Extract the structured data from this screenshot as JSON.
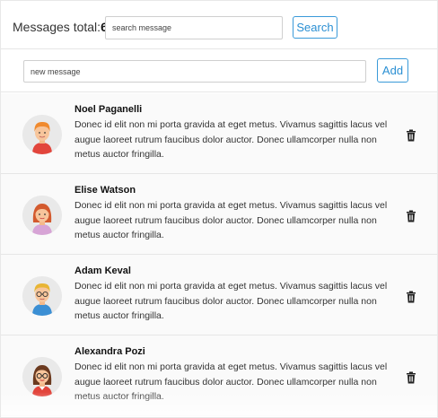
{
  "header": {
    "total_label": "Messages total:",
    "total_count": "6",
    "search_placeholder": "search message",
    "search_button": "Search"
  },
  "composer": {
    "placeholder": "new message",
    "add_button": "Add"
  },
  "messages": [
    {
      "author": "Noel Paganelli",
      "text": "Donec id elit non mi porta gravida at eget metus. Vivamus sagittis lacus vel augue laoreet rutrum faucibus dolor auctor. Donec ullamcorper nulla non metus auctor fringilla.",
      "avatar_icon": "man-red-hair-avatar-icon"
    },
    {
      "author": "Elise Watson",
      "text": "Donec id elit non mi porta gravida at eget metus. Vivamus sagittis lacus vel augue laoreet rutrum faucibus dolor auctor. Donec ullamcorper nulla non metus auctor fringilla.",
      "avatar_icon": "woman-red-hair-avatar-icon"
    },
    {
      "author": "Adam Keval",
      "text": "Donec id elit non mi porta gravida at eget metus. Vivamus sagittis lacus vel augue laoreet rutrum faucibus dolor auctor. Donec ullamcorper nulla non metus auctor fringilla.",
      "avatar_icon": "man-glasses-avatar-icon"
    },
    {
      "author": "Alexandra Pozi",
      "text": "Donec id elit non mi porta gravida at eget metus. Vivamus sagittis lacus vel augue laoreet rutrum faucibus dolor auctor. Donec ullamcorper nulla non metus auctor fringilla.",
      "avatar_icon": "woman-glasses-avatar-icon"
    }
  ],
  "colors": {
    "accent": "#2a8fd3",
    "border": "#e6e6e6",
    "row_background": "#fafafa"
  }
}
